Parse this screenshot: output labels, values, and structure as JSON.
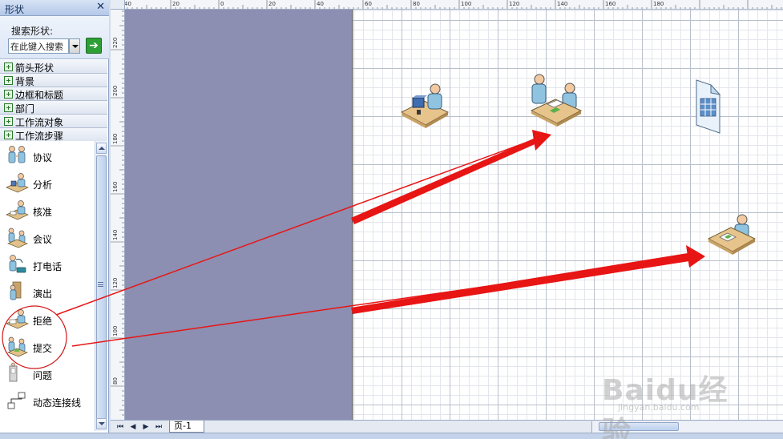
{
  "panel": {
    "title": "形状",
    "close_glyph": "✕",
    "search_label": "搜索形状:",
    "search_value": "在此键入搜索",
    "go_glyph": "➔"
  },
  "stencils": [
    {
      "label": "箭头形状"
    },
    {
      "label": "背景"
    },
    {
      "label": "边框和标题"
    },
    {
      "label": "部门"
    },
    {
      "label": "工作流对象"
    },
    {
      "label": "工作流步骤"
    }
  ],
  "shapes": [
    {
      "label": "协议",
      "icon": "two-people-icon"
    },
    {
      "label": "分析",
      "icon": "desk-worker-icon"
    },
    {
      "label": "核准",
      "icon": "desk-stamp-icon"
    },
    {
      "label": "会议",
      "icon": "meeting-icon"
    },
    {
      "label": "打电话",
      "icon": "phone-call-icon"
    },
    {
      "label": "演出",
      "icon": "presenter-icon"
    },
    {
      "label": "拒绝",
      "icon": "reject-icon"
    },
    {
      "label": "提交",
      "icon": "submit-icon"
    },
    {
      "label": "问题",
      "icon": "question-icon"
    },
    {
      "label": "动态连接线",
      "icon": "dynamic-connector-icon"
    }
  ],
  "rulers": {
    "top_labels": [
      "40",
      "20",
      "0",
      "20",
      "40",
      "60",
      "80",
      "100",
      "120",
      "140",
      "160",
      "180"
    ],
    "left_labels": [
      "220",
      "200",
      "180",
      "160",
      "140",
      "120",
      "100",
      "80"
    ]
  },
  "pagebar": {
    "first_glyph": "⏮",
    "prev_glyph": "◀",
    "next_glyph": "▶",
    "last_glyph": "⏭",
    "page_tab": "页-1"
  },
  "watermark": {
    "brand": "Baidu经验",
    "sub": "jingyan.baidu.com"
  },
  "colors": {
    "arrow": "#e81515",
    "circle": "#d01818",
    "canvas_bg": "#8c8fb1"
  }
}
